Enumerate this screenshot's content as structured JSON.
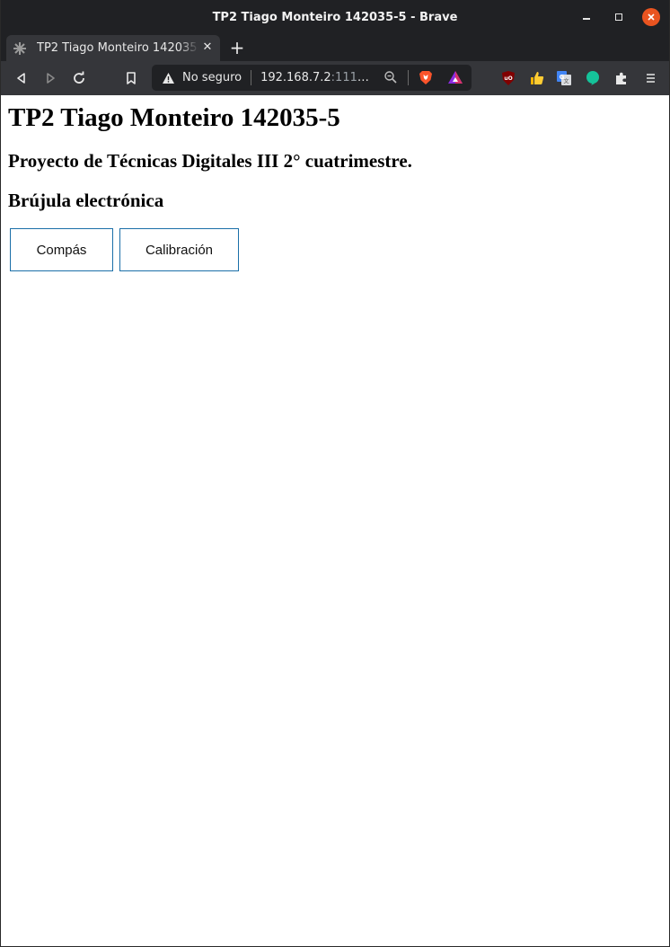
{
  "window": {
    "title": "TP2 Tiago Monteiro 142035-5 - Brave",
    "controls": {
      "minimize": "minimize-icon",
      "maximize": "maximize-icon",
      "close": "close-icon"
    }
  },
  "tabs": [
    {
      "title": "TP2 Tiago Monteiro 142035-5",
      "active": true
    }
  ],
  "toolbar": {
    "security_label": "No seguro",
    "url_host": "192.168.7.2",
    "url_rest": ":1111..."
  },
  "page": {
    "heading": "TP2 Tiago Monteiro 142035-5",
    "subheading": "Proyecto de Técnicas Digitales III 2° cuatrimestre.",
    "section_title": "Brújula electrónica",
    "buttons": [
      {
        "label": "Compás"
      },
      {
        "label": "Calibración"
      }
    ]
  },
  "colors": {
    "chrome_dark": "#202124",
    "chrome_tab": "#35363a",
    "close_button": "#e95420",
    "button_border": "#1b6fa8"
  }
}
